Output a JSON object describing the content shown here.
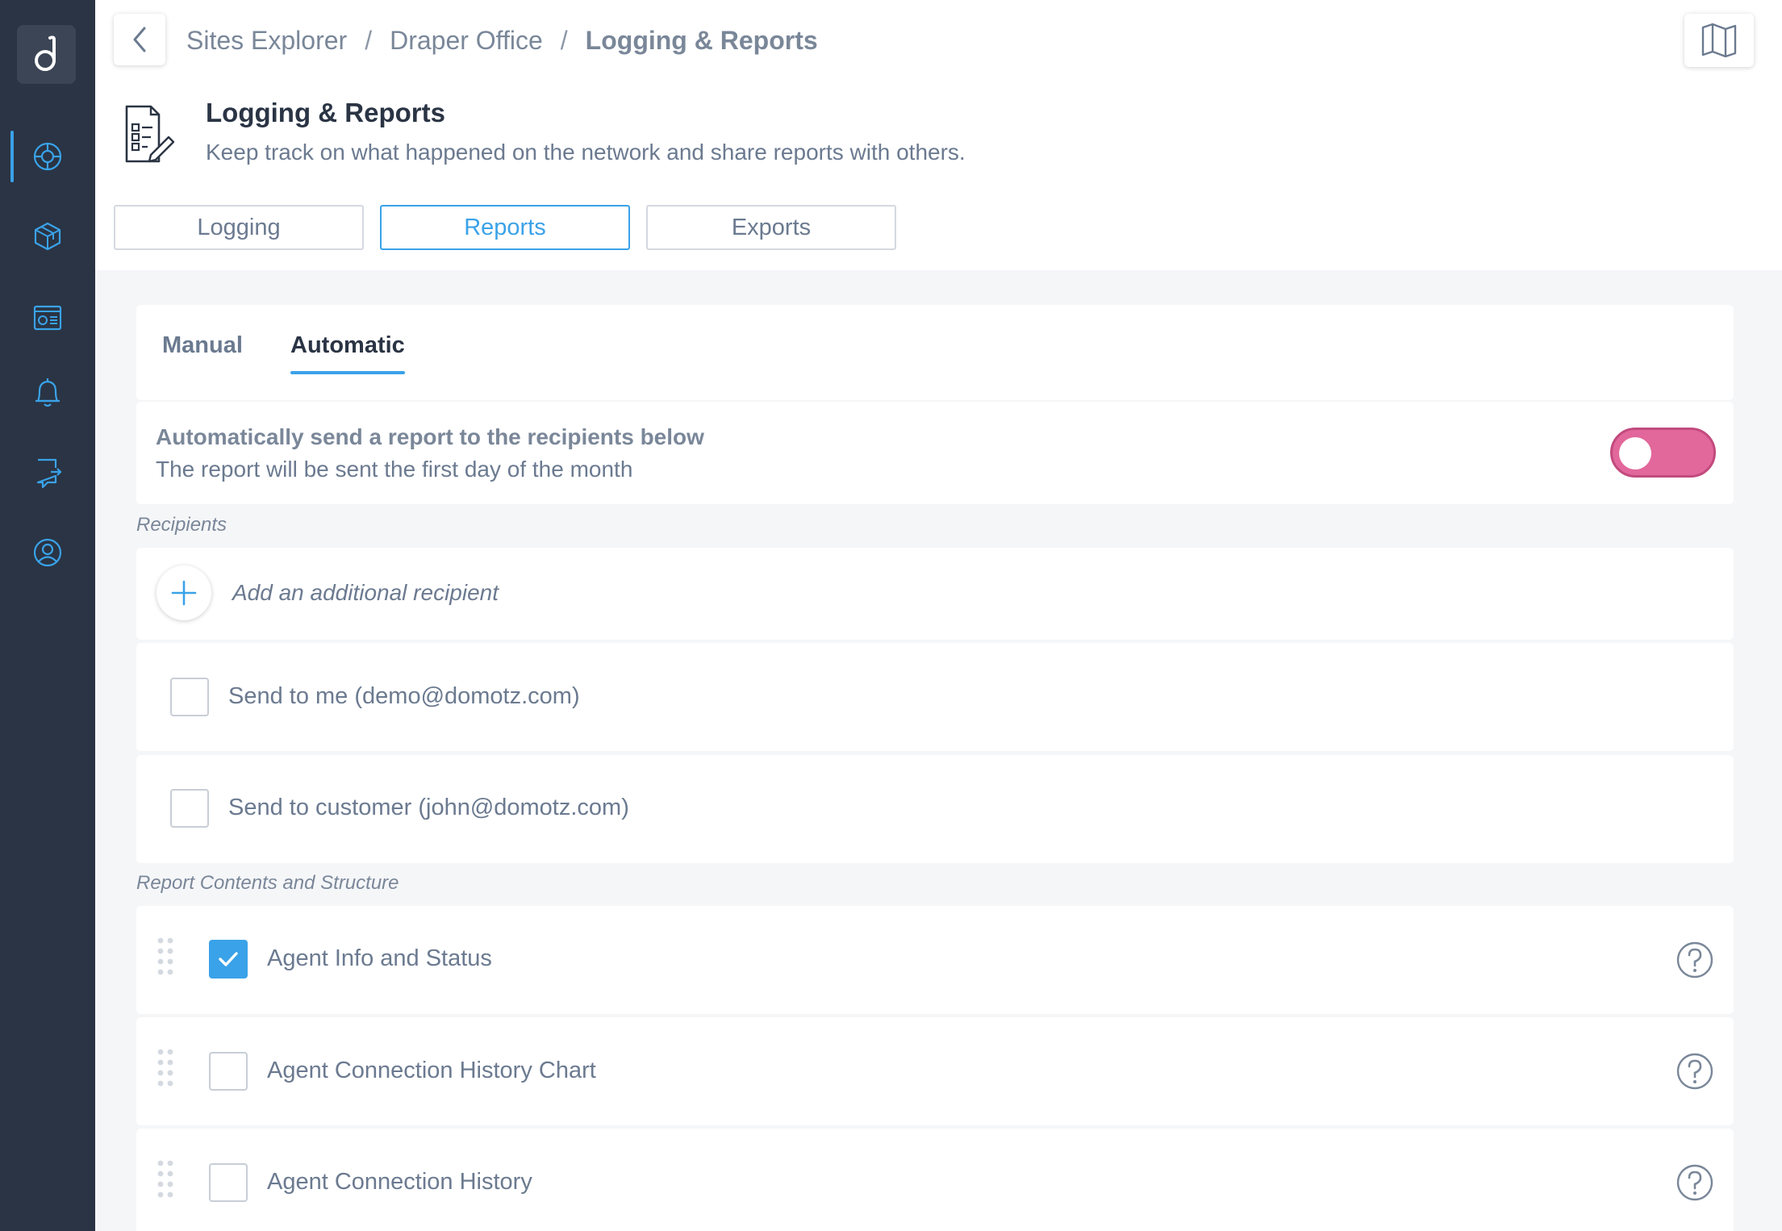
{
  "sidebar": {
    "logo": "d",
    "items": [
      {
        "icon": "globe-icon",
        "active": true
      },
      {
        "icon": "cube-icon",
        "active": false
      },
      {
        "icon": "dashboard-window-icon",
        "active": false
      },
      {
        "icon": "bell-icon",
        "active": false
      },
      {
        "icon": "integrations-icon",
        "active": false
      },
      {
        "icon": "user-circle-icon",
        "active": false
      }
    ]
  },
  "header": {
    "breadcrumb": [
      "Sites Explorer",
      "Draper Office",
      "Logging & Reports"
    ],
    "separator": "/",
    "title": "Logging & Reports",
    "subtitle": "Keep track on what happened on the network and share reports with others.",
    "segments": [
      "Logging",
      "Reports",
      "Exports"
    ],
    "active_segment": "Reports"
  },
  "subtabs": {
    "manual": "Manual",
    "automatic": "Automatic",
    "active": "Automatic"
  },
  "auto_send": {
    "title": "Automatically send a report to the recipients below",
    "subtitle": "The report will be sent the first day of the month",
    "enabled": false
  },
  "recipients": {
    "section_label": "Recipients",
    "add_label": "Add an additional recipient",
    "items": [
      {
        "label": "Send to me (demo@domotz.com)",
        "checked": false
      },
      {
        "label": "Send to customer (john@domotz.com)",
        "checked": false
      }
    ]
  },
  "contents": {
    "section_label": "Report Contents and Structure",
    "items": [
      {
        "label": "Agent Info and Status",
        "checked": true
      },
      {
        "label": "Agent Connection History Chart",
        "checked": false
      },
      {
        "label": "Agent Connection History",
        "checked": false
      }
    ]
  },
  "colors": {
    "sidebar_bg": "#2a3444",
    "accent_blue": "#3aa2e8",
    "toggle_pink": "#e2679b"
  }
}
